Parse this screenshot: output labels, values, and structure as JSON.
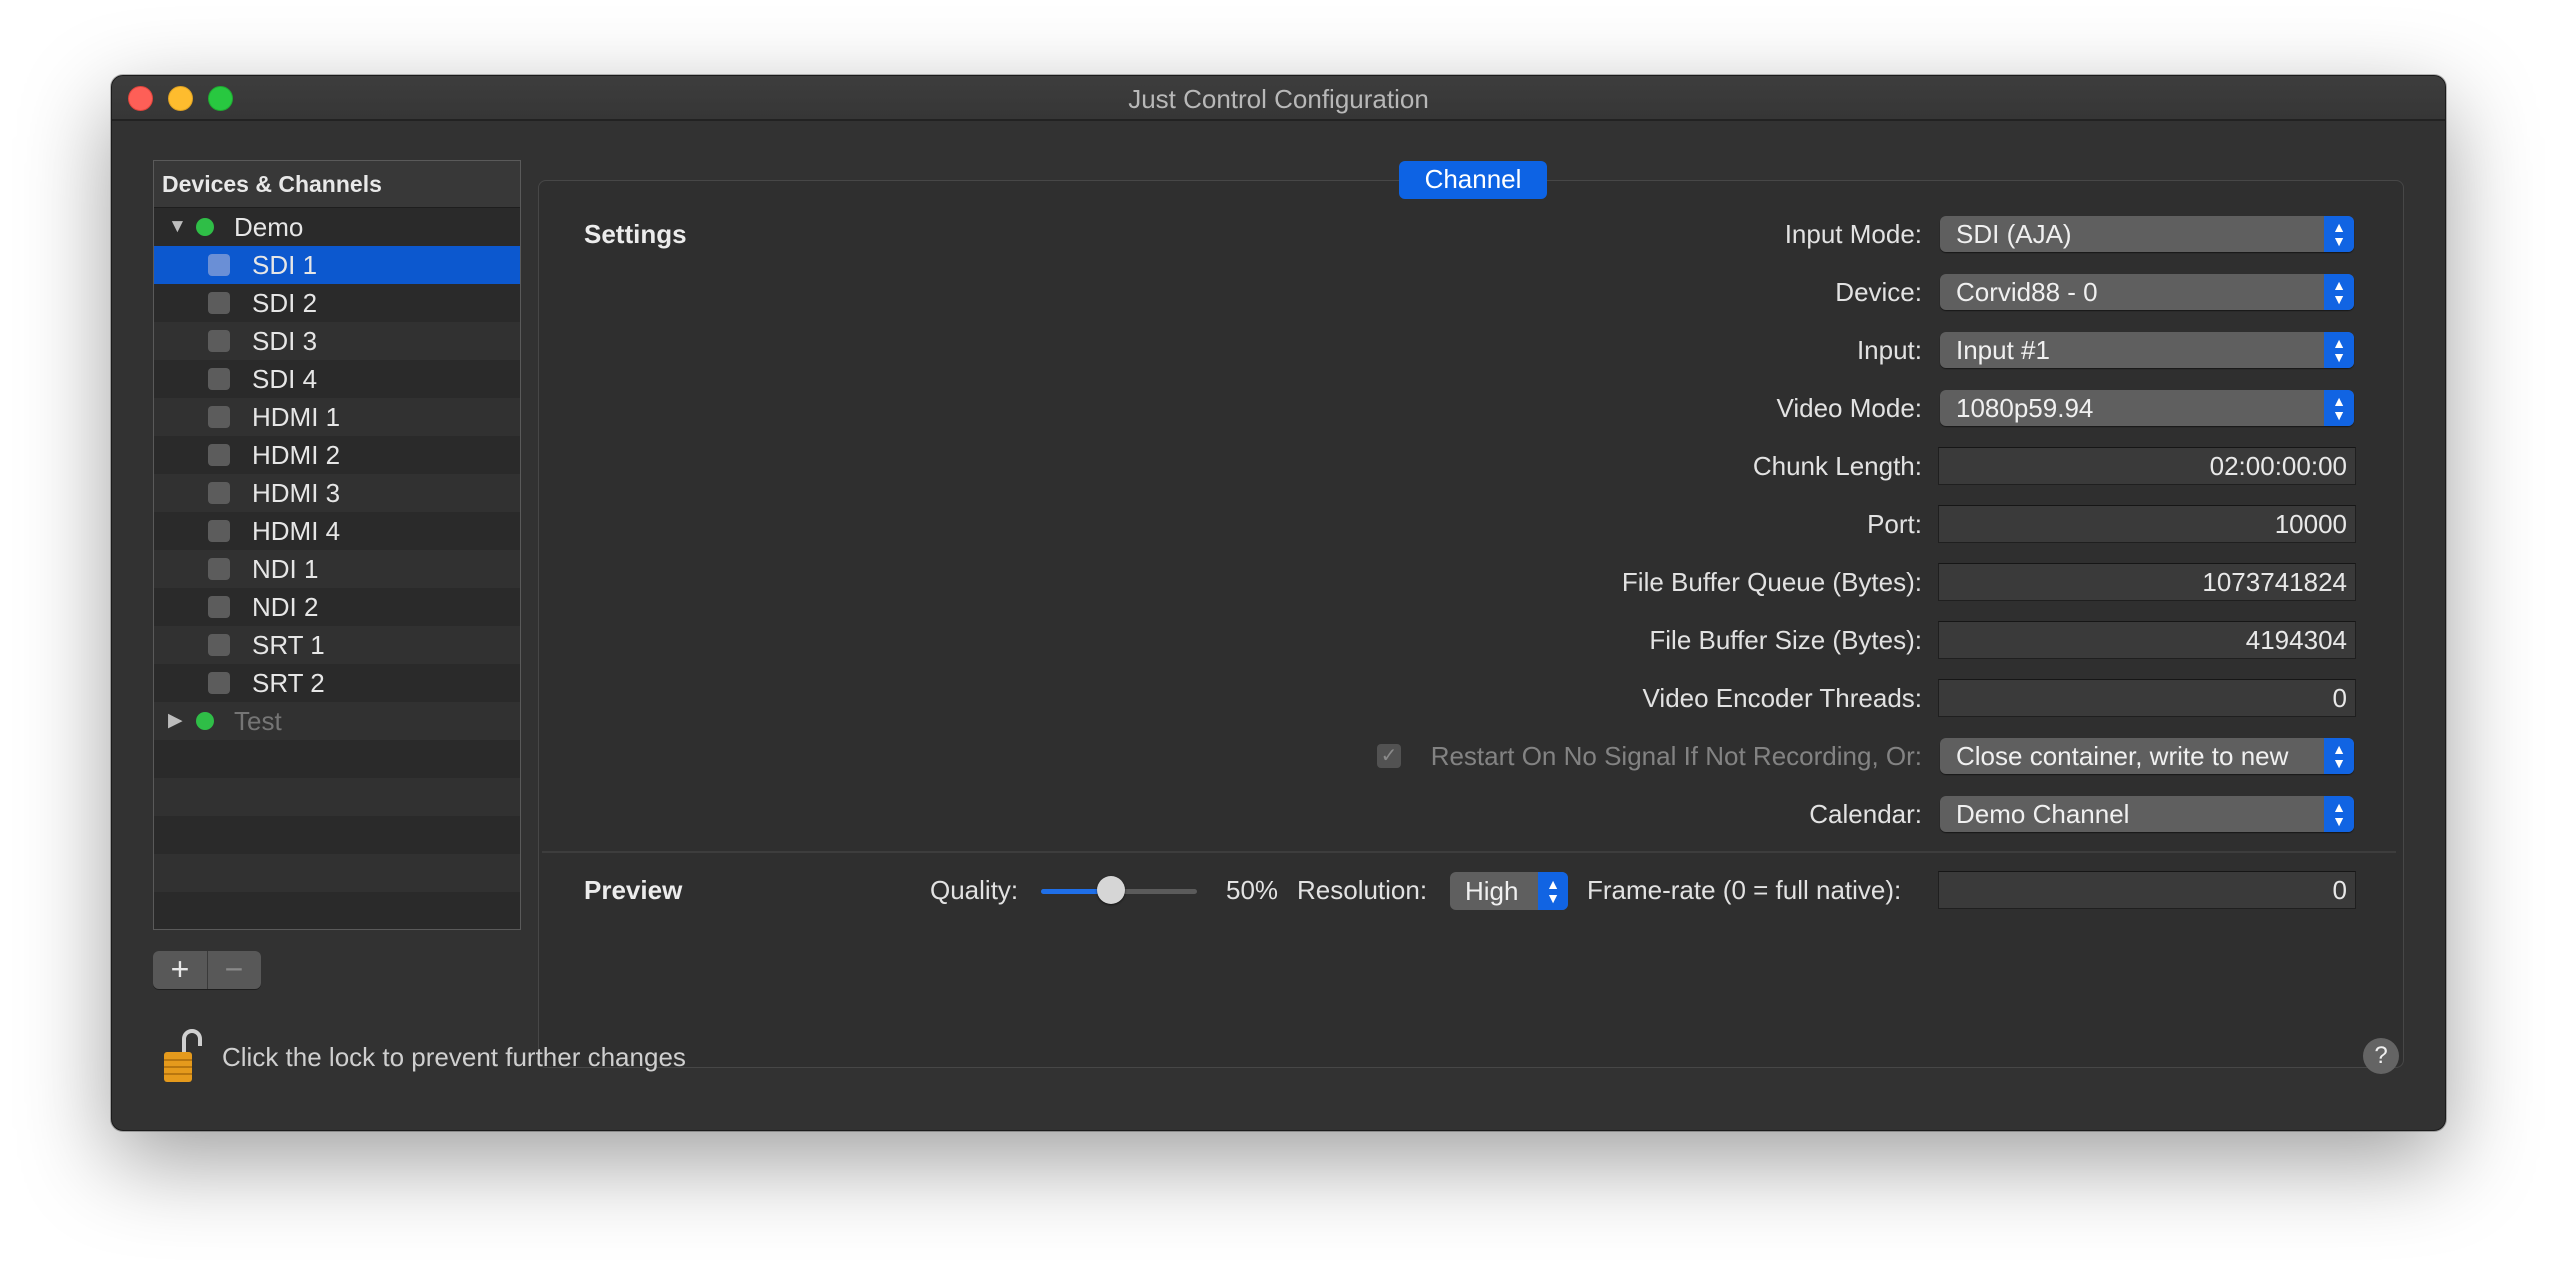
{
  "window": {
    "title": "Just Control Configuration"
  },
  "sidebar": {
    "header": "Devices & Channels",
    "groups": [
      {
        "label": "Demo",
        "expanded": true,
        "status_color": "#2fbe47",
        "channels": [
          "SDI 1",
          "SDI 2",
          "SDI 3",
          "SDI 4",
          "HDMI 1",
          "HDMI 2",
          "HDMI 3",
          "HDMI 4",
          "NDI 1",
          "NDI 2",
          "SRT 1",
          "SRT 2"
        ],
        "selected": "SDI 1"
      },
      {
        "label": "Test",
        "expanded": false,
        "status_color": "#2fbe47"
      }
    ],
    "add_button": "+",
    "remove_button": "−"
  },
  "tab": {
    "label": "Channel"
  },
  "settings": {
    "title": "Settings",
    "input_mode": {
      "label": "Input Mode:",
      "value": "SDI (AJA)"
    },
    "device": {
      "label": "Device:",
      "value": "Corvid88 - 0"
    },
    "input": {
      "label": "Input:",
      "value": "Input #1"
    },
    "video_mode": {
      "label": "Video Mode:",
      "value": "1080p59.94"
    },
    "chunk_length": {
      "label": "Chunk Length:",
      "value": "02:00:00:00"
    },
    "port": {
      "label": "Port:",
      "value": "10000"
    },
    "file_buffer_queue": {
      "label": "File Buffer Queue (Bytes):",
      "value": "1073741824"
    },
    "file_buffer_size": {
      "label": "File Buffer Size (Bytes):",
      "value": "4194304"
    },
    "video_encoder_threads": {
      "label": "Video Encoder Threads:",
      "value": "0"
    },
    "restart": {
      "label": "Restart On No Signal If Not Recording, Or:",
      "checked": true,
      "value": "Close container, write to new"
    },
    "calendar": {
      "label": "Calendar:",
      "value": "Demo Channel"
    }
  },
  "preview": {
    "title": "Preview",
    "quality_label": "Quality:",
    "quality_value": 0.5,
    "quality_text": "50%",
    "resolution_label": "Resolution:",
    "resolution_value": "High",
    "framerate_label": "Frame-rate (0 = full native):",
    "framerate_value": "0"
  },
  "footer": {
    "lock_text": "Click the lock to prevent further changes",
    "help": "?"
  },
  "colors": {
    "accent": "#0d63e4",
    "selection": "#0c58cf",
    "status_green": "#2fbe47"
  }
}
